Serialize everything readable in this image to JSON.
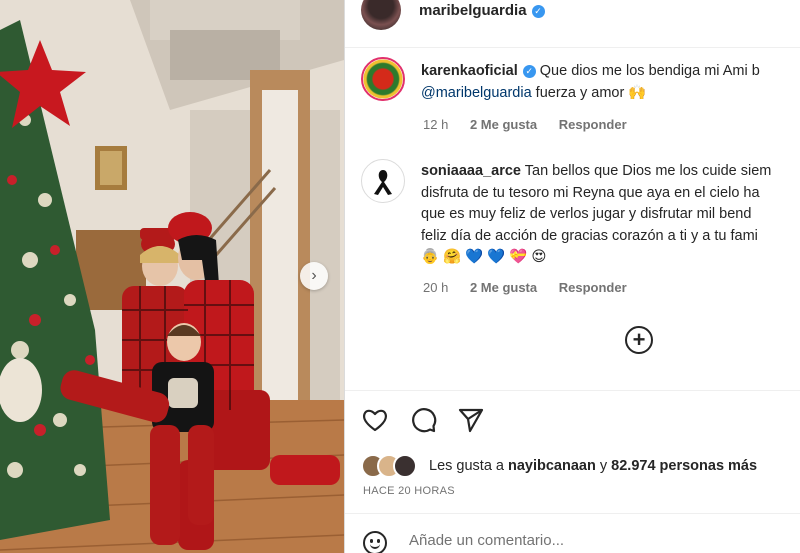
{
  "header": {
    "username": "maribelguardia",
    "verified": true
  },
  "comments": [
    {
      "username": "karenkaoficial",
      "verified": true,
      "text_line1": "Que dios me los bendiga mi Ami b",
      "mention": "@maribelguardia",
      "text_line2_rest": " fuerza y amor 🙌",
      "time": "12 h",
      "likes": "2 Me gusta",
      "reply": "Responder"
    },
    {
      "username": "soniaaaa_arce",
      "lines": [
        "Tan bellos que Dios me los cuide siem",
        "disfruta de tu tesoro mi Reyna que aya en el cielo ha",
        "que es muy feliz de verlos jugar y disfrutar mil bend",
        "feliz día de acción de gracias corazón a ti y a tu fami",
        "👵 🤗 💙 💙 💝 😍"
      ],
      "time": "20 h",
      "likes": "2 Me gusta",
      "reply": "Responder"
    }
  ],
  "load_more_icon": "plus-circle-icon",
  "actions": {
    "like_icon": "heart-icon",
    "comment_icon": "comment-icon",
    "share_icon": "send-icon"
  },
  "likes_summary": {
    "prefix": "Les gusta a ",
    "user": "nayibcanaan",
    "middle": " y ",
    "count": "82.974 personas más"
  },
  "timestamp": "HACE 20 HORAS",
  "add_comment": {
    "placeholder": "Añade un comentario..."
  },
  "colors": {
    "verified": "#3897f0",
    "mention": "#00376b",
    "muted": "#737373"
  }
}
